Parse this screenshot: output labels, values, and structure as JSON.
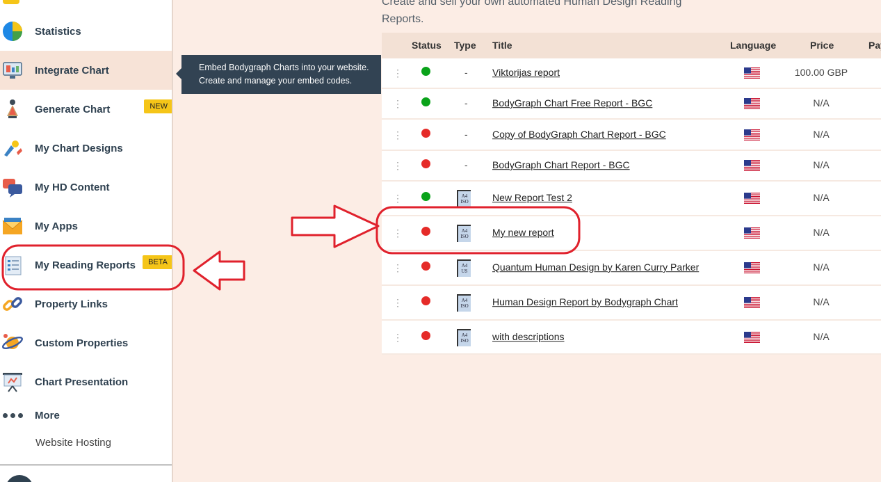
{
  "sidebar": {
    "items": [
      {
        "label": "Statistics",
        "badge": ""
      },
      {
        "label": "Integrate Chart",
        "badge": ""
      },
      {
        "label": "Generate Chart",
        "badge": "NEW"
      },
      {
        "label": "My Chart Designs",
        "badge": ""
      },
      {
        "label": "My HD Content",
        "badge": ""
      },
      {
        "label": "My Apps",
        "badge": ""
      },
      {
        "label": "My Reading Reports",
        "badge": "BETA"
      },
      {
        "label": "Property Links",
        "badge": ""
      },
      {
        "label": "Custom Properties",
        "badge": ""
      },
      {
        "label": "Chart Presentation",
        "badge": ""
      }
    ],
    "more_label": "More",
    "sub_link": "Website Hosting"
  },
  "tooltip": {
    "line1": "Embed Bodygraph Charts into your website.",
    "line2": "Create and manage your embed codes."
  },
  "intro": {
    "line1": "Create and sell your own automated Human Design Reading",
    "line2": "Reports."
  },
  "table": {
    "headers": {
      "status": "Status",
      "type": "Type",
      "title": "Title",
      "language": "Language",
      "price": "Price",
      "pay": "Pay"
    },
    "rows": [
      {
        "status": "green",
        "type": "-",
        "doc": "",
        "title": "Viktorijas report",
        "price": "100.00 GBP"
      },
      {
        "status": "green",
        "type": "-",
        "doc": "",
        "title": "BodyGraph Chart Free Report - BGC",
        "price": "N/A"
      },
      {
        "status": "red",
        "type": "-",
        "doc": "",
        "title": "Copy of BodyGraph Chart Report - BGC",
        "price": "N/A"
      },
      {
        "status": "red",
        "type": "-",
        "doc": "",
        "title": "BodyGraph Chart Report - BGC",
        "price": "N/A"
      },
      {
        "status": "green",
        "type": "",
        "doc": "A4 ISO",
        "title": "New Report Test 2",
        "price": "N/A"
      },
      {
        "status": "red",
        "type": "",
        "doc": "A4 ISO",
        "title": "My new report",
        "price": "N/A"
      },
      {
        "status": "red",
        "type": "",
        "doc": "A4 US",
        "title": "Quantum Human Design by Karen Curry Parker",
        "price": "N/A"
      },
      {
        "status": "red",
        "type": "",
        "doc": "A4 ISO",
        "title": "Human Design Report by Bodygraph Chart",
        "price": "N/A"
      },
      {
        "status": "red",
        "type": "",
        "doc": "A4 ISO",
        "title": "with descriptions",
        "price": "N/A"
      }
    ]
  },
  "colors": {
    "status_green": "#0aa31a",
    "status_red": "#e52b28",
    "annotation_red": "#e0212c",
    "tooltip_bg": "#324353"
  }
}
